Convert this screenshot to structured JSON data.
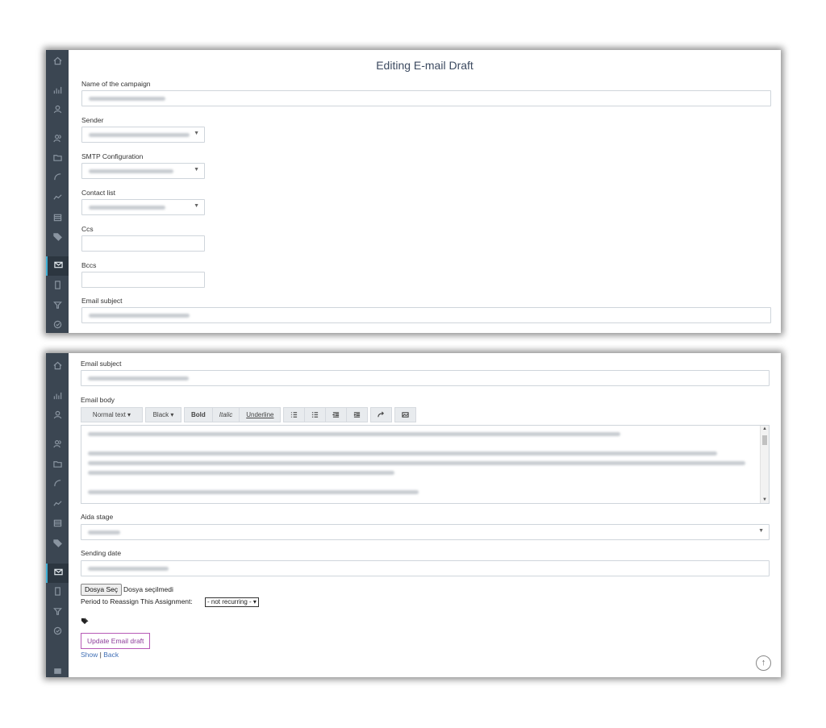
{
  "top": {
    "title": "Editing E-mail Draft",
    "campaign_label": "Name of the campaign",
    "sender_label": "Sender",
    "smtp_label": "SMTP Configuration",
    "contact_label": "Contact list",
    "ccs_label": "Ccs",
    "bccs_label": "Bccs",
    "subject_label": "Email subject"
  },
  "bottom": {
    "subject_label": "Email subject",
    "body_label": "Email body",
    "toolbar": {
      "normal_text": "Normal text ▾",
      "color": "Black ▾",
      "bold": "Bold",
      "italic": "Italic",
      "underline": "Underline"
    },
    "aida_label": "Aida stage",
    "sending_label": "Sending date",
    "file_button": "Dosya Seç",
    "file_status": "Dosya seçilmedi",
    "period_label": "Period to Reassign This Assignment:",
    "period_value": "- not recurring - ▾",
    "update_button": "Update Email draft",
    "show_link": "Show",
    "link_sep": "|",
    "back_link": "Back"
  },
  "colors": {
    "sidebar": "#3b4652",
    "accent": "#3fb0d6",
    "update_button": "#8c3c9a",
    "link": "#3f6fb5"
  }
}
